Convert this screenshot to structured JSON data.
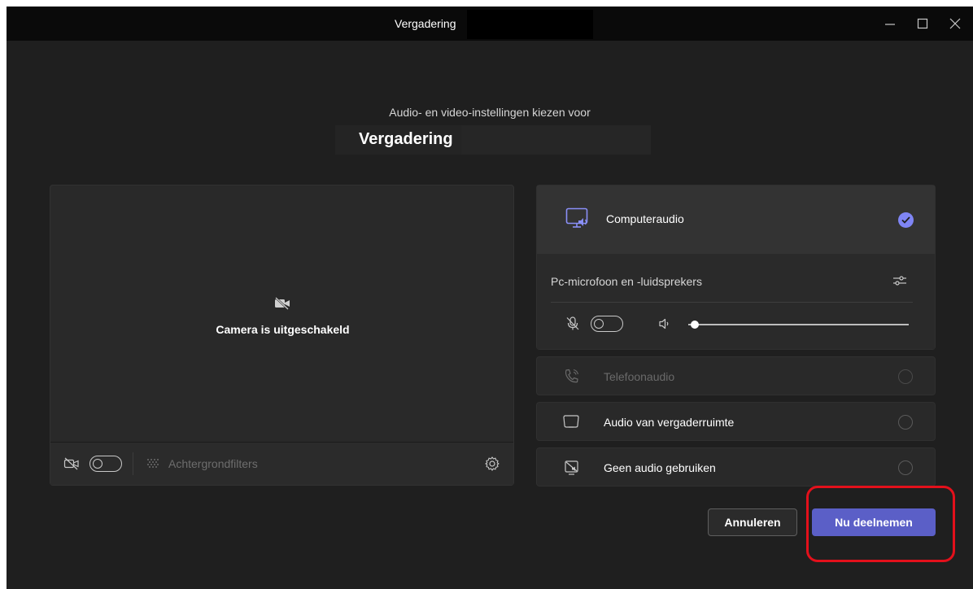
{
  "window": {
    "title": "Vergadering"
  },
  "header": {
    "subtitle": "Audio- en video-instellingen kiezen voor",
    "meeting_name": "Vergadering"
  },
  "video": {
    "camera_off_text": "Camera is uitgeschakeld",
    "background_filters_label": "Achtergrondfilters",
    "camera_toggle_on": false
  },
  "audio": {
    "options": {
      "computer": {
        "label": "Computeraudio",
        "selected": true
      },
      "device_label": "Pc-microfoon en -luidsprekers",
      "mic_toggle_on": false,
      "volume_level": 0.03,
      "phone": {
        "label": "Telefoonaudio",
        "selected": false,
        "disabled": true
      },
      "room": {
        "label": "Audio van vergaderruimte",
        "selected": false
      },
      "none": {
        "label": "Geen audio gebruiken",
        "selected": false
      }
    }
  },
  "actions": {
    "cancel_label": "Annuleren",
    "join_label": "Nu deelnemen"
  },
  "colors": {
    "accent": "#5b5fc7",
    "check": "#7f85f5",
    "highlight": "#e3101b"
  }
}
